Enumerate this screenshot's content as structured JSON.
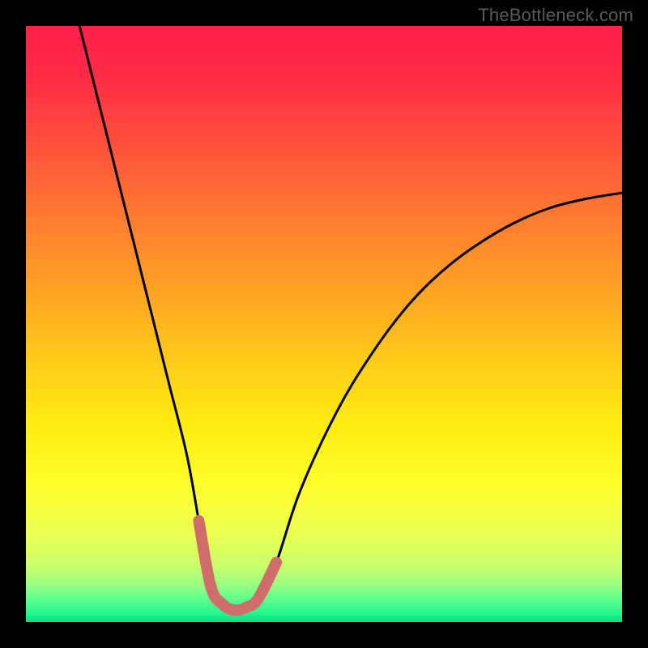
{
  "watermark": "TheBottleneck.com",
  "colors": {
    "frame": "#000000",
    "curve": "#000000",
    "highlight": "#cf6d6c",
    "gradient_stops": [
      {
        "offset": 0.0,
        "color": "#ff1f47"
      },
      {
        "offset": 0.08,
        "color": "#ff2a45"
      },
      {
        "offset": 0.18,
        "color": "#ff4a3e"
      },
      {
        "offset": 0.3,
        "color": "#ff7433"
      },
      {
        "offset": 0.42,
        "color": "#ff9b26"
      },
      {
        "offset": 0.55,
        "color": "#ffc81a"
      },
      {
        "offset": 0.68,
        "color": "#ffee12"
      },
      {
        "offset": 0.78,
        "color": "#fdff30"
      },
      {
        "offset": 0.86,
        "color": "#e8ff55"
      },
      {
        "offset": 0.905,
        "color": "#c8ff6a"
      },
      {
        "offset": 0.935,
        "color": "#9dff80"
      },
      {
        "offset": 0.96,
        "color": "#63ff8f"
      },
      {
        "offset": 0.985,
        "color": "#24f58e"
      },
      {
        "offset": 1.0,
        "color": "#0bdc84"
      }
    ]
  },
  "chart_data": {
    "type": "line",
    "title": "",
    "xlabel": "",
    "ylabel": "",
    "xlim": [
      0,
      100
    ],
    "ylim": [
      0,
      100
    ],
    "grid": false,
    "legend": false,
    "notes": "V-shaped bottleneck curve. Valley floor near y≈2 over x≈31–39; left arm starts at (≈9,100), right arm ends at (100,≈72). Highlight segment spans roughly x≈29–42.",
    "series": [
      {
        "name": "bottleneck-curve",
        "x": [
          9,
          12,
          15,
          18,
          21,
          24,
          27,
          29,
          31,
          33,
          35,
          37,
          39,
          42,
          46,
          52,
          58,
          64,
          70,
          76,
          82,
          88,
          94,
          100
        ],
        "y": [
          100,
          88,
          76,
          64,
          52,
          40,
          28,
          17,
          6,
          3,
          2,
          2.5,
          4,
          10,
          22,
          35,
          45,
          53,
          59,
          63.5,
          67,
          69.5,
          71,
          72
        ]
      },
      {
        "name": "valley-highlight",
        "x": [
          29,
          31,
          33,
          35,
          37,
          39,
          42
        ],
        "y": [
          17,
          6,
          3,
          2,
          2.5,
          4,
          10
        ]
      }
    ]
  }
}
